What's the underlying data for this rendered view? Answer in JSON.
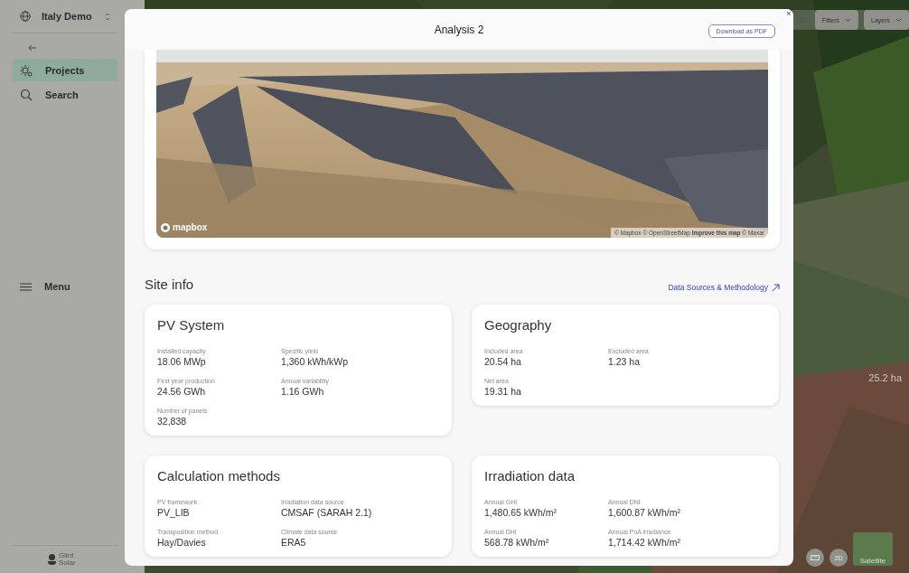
{
  "sidebar": {
    "workspace": "Italy Demo",
    "items": [
      {
        "label": "Projects",
        "selected": true
      },
      {
        "label": "Search",
        "selected": false
      }
    ],
    "menu": "Menu",
    "brand": "Glint Solar"
  },
  "map": {
    "controls": [
      "Filters",
      "Layers"
    ],
    "area_label": "25.2 ha",
    "view_button": "2D",
    "basemap_label": "Satellite"
  },
  "modal": {
    "title": "Analysis 2",
    "download_button": "Download as PDF",
    "close": "×",
    "picture": {
      "kind": "picture",
      "logo": "mapbox",
      "attribution": "© Mapbox © OpenStreetMap **Improve this map** © Maxar"
    },
    "section_title": "Site info",
    "methodology_link": "Data Sources & Methodology",
    "cards": [
      {
        "title": "PV System",
        "fields": [
          {
            "label": "Installed capacity",
            "value": "18.06 MWp"
          },
          {
            "label": "Specific yield",
            "value": "1,360 kWh/kWp"
          },
          {
            "label": "First year production",
            "value": "24.56 GWh"
          },
          {
            "label": "Annual variability",
            "value": "1.16 GWh"
          },
          {
            "label": "Number of panels",
            "value": "32,838"
          }
        ]
      },
      {
        "title": "Geography",
        "fields": [
          {
            "label": "Included area",
            "value": "20.54 ha"
          },
          {
            "label": "Excluded area",
            "value": "1.23 ha"
          },
          {
            "label": "Net area",
            "value": "19.31 ha"
          }
        ]
      },
      {
        "title": "Calculation methods",
        "fields": [
          {
            "label": "PV framework",
            "value": "PV_LIB"
          },
          {
            "label": "Irradiation data source",
            "value": "CMSAF (SARAH 2.1)"
          },
          {
            "label": "Transposition method",
            "value": "Hay/Davies"
          },
          {
            "label": "Climate data source",
            "value": "ERA5"
          }
        ]
      },
      {
        "title": "Irradiation data",
        "fields": [
          {
            "label": "Annual GHI",
            "value": "1,480.65 kWh/m²"
          },
          {
            "label": "Annual DNI",
            "value": "1,600.87 kWh/m²"
          },
          {
            "label": "Annual DHI",
            "value": "568.78 kWh/m²"
          },
          {
            "label": "Annual PoA irradiance",
            "value": "1,714.42 kWh/m²"
          }
        ]
      }
    ]
  }
}
